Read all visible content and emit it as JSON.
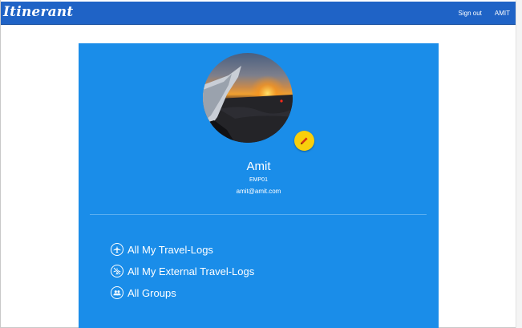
{
  "navbar": {
    "brand": "Itinerant",
    "links": [
      "Sign out",
      "AMIT"
    ]
  },
  "profile": {
    "name": "Amit",
    "employee_id": "EMP01",
    "email": "amit@amit.com",
    "edit_icon": "pencil-icon"
  },
  "menu": {
    "items": [
      {
        "label": "All My Travel-Logs",
        "icon": "airplane-icon"
      },
      {
        "label": "All My External Travel-Logs",
        "icon": "airplane-off-icon"
      },
      {
        "label": "All Groups",
        "icon": "group-icon"
      }
    ]
  },
  "colors": {
    "navbar": "#1f63c6",
    "card": "#1a8de9",
    "edit_button": "#f8cf0c",
    "text": "#ffffff"
  }
}
